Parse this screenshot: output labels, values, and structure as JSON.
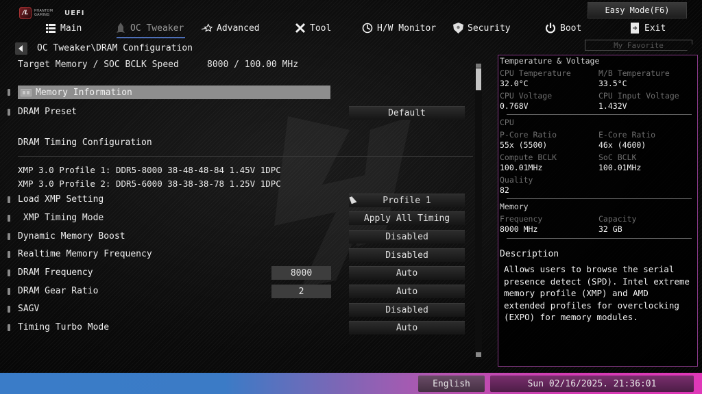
{
  "brand": {
    "logo_line1": "PHANTOM",
    "logo_line2": "GAMING",
    "uefi": "UEFI"
  },
  "nav": {
    "items": [
      {
        "label": "Main",
        "icon": "list-icon"
      },
      {
        "label": "OC Tweaker",
        "icon": "rocket-icon",
        "active": true
      },
      {
        "label": "Advanced",
        "icon": "star-icon"
      },
      {
        "label": "Tool",
        "icon": "tools-icon"
      },
      {
        "label": "H/W Monitor",
        "icon": "monitor-icon"
      },
      {
        "label": "Security",
        "icon": "shield-icon"
      },
      {
        "label": "Boot",
        "icon": "power-icon"
      },
      {
        "label": "Exit",
        "icon": "exit-door-icon"
      }
    ],
    "easy_mode": "Easy Mode(F6)",
    "my_favorite": "My Favorite"
  },
  "breadcrumb": "OC Tweaker\\DRAM Configuration",
  "target": {
    "label": "Target Memory / SOC BCLK Speed",
    "value": "8000 / 100.00 MHz"
  },
  "settings": {
    "memory_information": "Memory Information",
    "dram_preset": {
      "label": "DRAM Preset",
      "value": "Default"
    },
    "timing_section": "DRAM Timing Configuration",
    "xmp_profiles": [
      "XMP 3.0 Profile 1: DDR5-8000 38-48-48-84 1.45V 1DPC",
      "XMP 3.0 Profile 2: DDR5-6000 38-38-38-78 1.25V 1DPC"
    ],
    "rows": [
      {
        "label": "Load XMP Setting",
        "value": "Profile 1"
      },
      {
        "label": " XMP Timing Mode",
        "value": "Apply All Timing"
      },
      {
        "label": "Dynamic Memory Boost",
        "value": "Disabled"
      },
      {
        "label": "Realtime Memory Frequency",
        "value": "Disabled"
      },
      {
        "label": "DRAM Frequency",
        "current": "8000",
        "value": "Auto"
      },
      {
        "label": "DRAM Gear Ratio",
        "current": "2",
        "value": "Auto"
      },
      {
        "label": "SAGV",
        "value": "Disabled"
      },
      {
        "label": "Timing Turbo Mode",
        "value": "Auto"
      }
    ]
  },
  "panel": {
    "tv_title": "Temperature & Voltage",
    "cpu_temp_label": "CPU Temperature",
    "cpu_temp": "32.0°C",
    "mb_temp_label": "M/B Temperature",
    "mb_temp": "33.5°C",
    "cpu_volt_label": "CPU Voltage",
    "cpu_volt": "0.768V",
    "cpu_in_volt_label": "CPU Input Voltage",
    "cpu_in_volt": "1.432V",
    "cpu_title": "CPU",
    "pcore_label": "P-Core Ratio",
    "pcore": "55x (5500)",
    "ecore_label": "E-Core Ratio",
    "ecore": "46x (4600)",
    "compute_bclk_label": "Compute BCLK",
    "compute_bclk": "100.01MHz",
    "soc_bclk_label": "SoC BCLK",
    "soc_bclk": "100.01MHz",
    "quality_label": "Quality",
    "quality": "82",
    "mem_title": "Memory",
    "freq_label": "Frequency",
    "freq": "8000 MHz",
    "cap_label": "Capacity",
    "cap": "32 GB",
    "desc_title": "Description",
    "desc_text": "Allows users to browse the serial presence detect (SPD). Intel extreme memory profile (XMP) and AMD extended profiles for overclocking (EXPO) for memory modules."
  },
  "footer": {
    "language": "English",
    "datetime": "Sun 02/16/2025. 21:36:01"
  },
  "colors": {
    "panel_border": "#8b3a8b",
    "active_tab_underline": "#4d6fb8",
    "selected_row": "#8e8e8e"
  }
}
